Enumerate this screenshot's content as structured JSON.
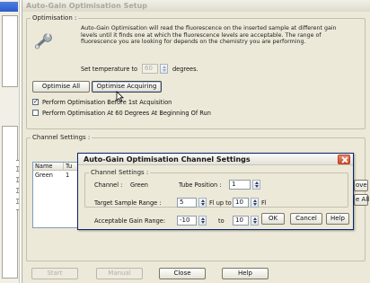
{
  "window": {
    "title": "Auto-Gain Optimisation Setup"
  },
  "optimisation": {
    "group_label": "Optimisation :",
    "description": "Auto-Gain Optimisation will read the fluorescence on the inserted sample at different gain levels until it finds one at which the fluorescence levels are acceptable. The range of fluorescence you are looking for depends on the chemistry you are performing.",
    "temp_label": "Set temperature to",
    "temp_value": "60",
    "temp_unit": "degrees.",
    "optimise_all": "Optimise All",
    "optimise_acquiring": "Optimise Acquiring",
    "check_before": {
      "label": "Perform Optimisation Before 1st Acquisition",
      "checked": true
    },
    "check_60deg": {
      "label": "Perform Optimisation At 60 Degrees At Beginning Of Run",
      "checked": false
    }
  },
  "channel_settings": {
    "group_label": "Channel Settings :",
    "columns": [
      "Name",
      "Tu"
    ],
    "rows": [
      [
        "Green",
        "1"
      ]
    ],
    "side_buttons": [
      "ove",
      "e All"
    ]
  },
  "bottom_buttons": {
    "start": "Start",
    "manual": "Manual",
    "close": "Close",
    "help": "Help"
  },
  "dialog": {
    "title": "Auto-Gain Optimisation Channel Settings",
    "group_label": "Channel Settings :",
    "channel_label": "Channel :",
    "channel_value": "Green",
    "tube_label": "Tube Position :",
    "tube_value": "1",
    "range_label": "Target Sample Range :",
    "range_from": "5",
    "range_mid": "Fl up to",
    "range_to": "10",
    "range_unit": "Fl",
    "gain_label": "Acceptable Gain Range:",
    "gain_from": "-10",
    "gain_mid": "to",
    "gain_to": "10",
    "ok": "OK",
    "cancel": "Cancel",
    "help": "Help"
  }
}
